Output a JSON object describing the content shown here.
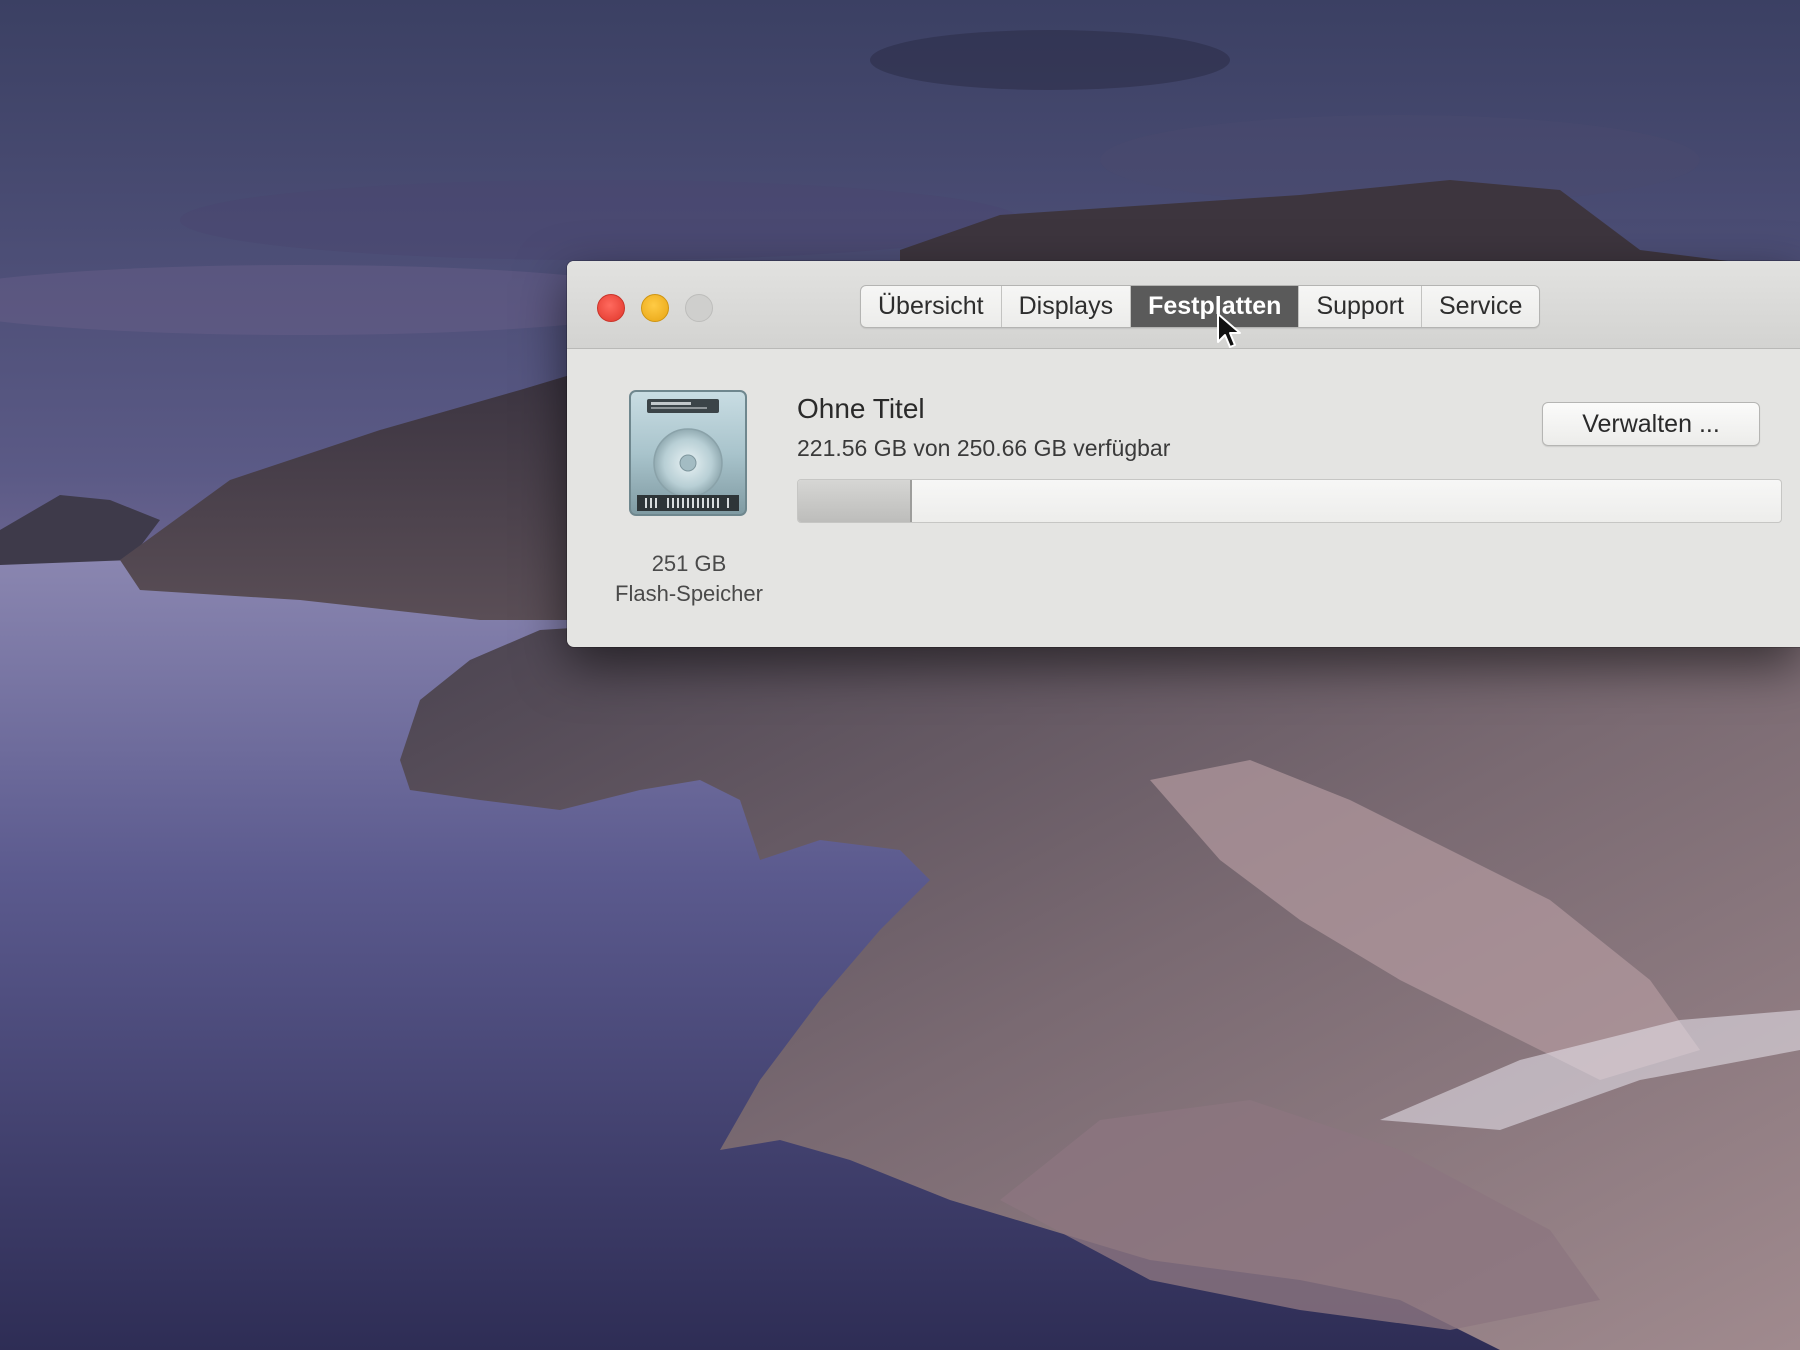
{
  "window": {
    "tabs": [
      {
        "label": "Übersicht",
        "active": false
      },
      {
        "label": "Displays",
        "active": false
      },
      {
        "label": "Festplatten",
        "active": true
      },
      {
        "label": "Support",
        "active": false
      },
      {
        "label": "Service",
        "active": false
      }
    ],
    "traffic_lights": {
      "close_color": "#ff5f52",
      "minimize_color": "#f7b32b",
      "zoom_color": "#cfcfcd"
    }
  },
  "disk": {
    "icon": "hard-drive-icon",
    "size_label": "251 GB",
    "type_label": "Flash-Speicher",
    "volume_name": "Ohne Titel",
    "availability": "221.56 GB von 250.66 GB verfügbar",
    "used_fraction": 0.116,
    "manage_button": "Verwalten ..."
  },
  "colors": {
    "active_tab": "#5a5a5a",
    "window_bg": "#e4e4e2"
  }
}
